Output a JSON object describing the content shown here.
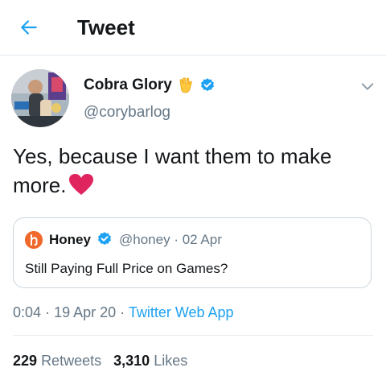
{
  "header": {
    "title": "Tweet",
    "back_icon": "arrow-left-icon"
  },
  "author": {
    "name": "Cobra Glory",
    "emoji_icon": "vulcan-salute-icon",
    "verified_icon": "verified-badge-icon",
    "handle": "@corybarlog"
  },
  "tweet": {
    "text": "Yes, because I want them to make more.",
    "emoji_icon": "red-heart-icon"
  },
  "quote": {
    "name": "Honey",
    "handle": "@honey",
    "separator": "·",
    "date": "02 Apr",
    "text": "Still Paying Full Price on Games?"
  },
  "meta": {
    "time": "0:04",
    "separator": "·",
    "date": "19 Apr 20",
    "app": "Twitter Web App"
  },
  "stats": {
    "retweets_count": "229",
    "retweets_label": "Retweets",
    "likes_count": "3,310",
    "likes_label": "Likes"
  },
  "colors": {
    "accent": "#1da1f2",
    "secondary_text": "#657786",
    "heart": "#e0245e",
    "honey_brand": "#f0692c"
  }
}
